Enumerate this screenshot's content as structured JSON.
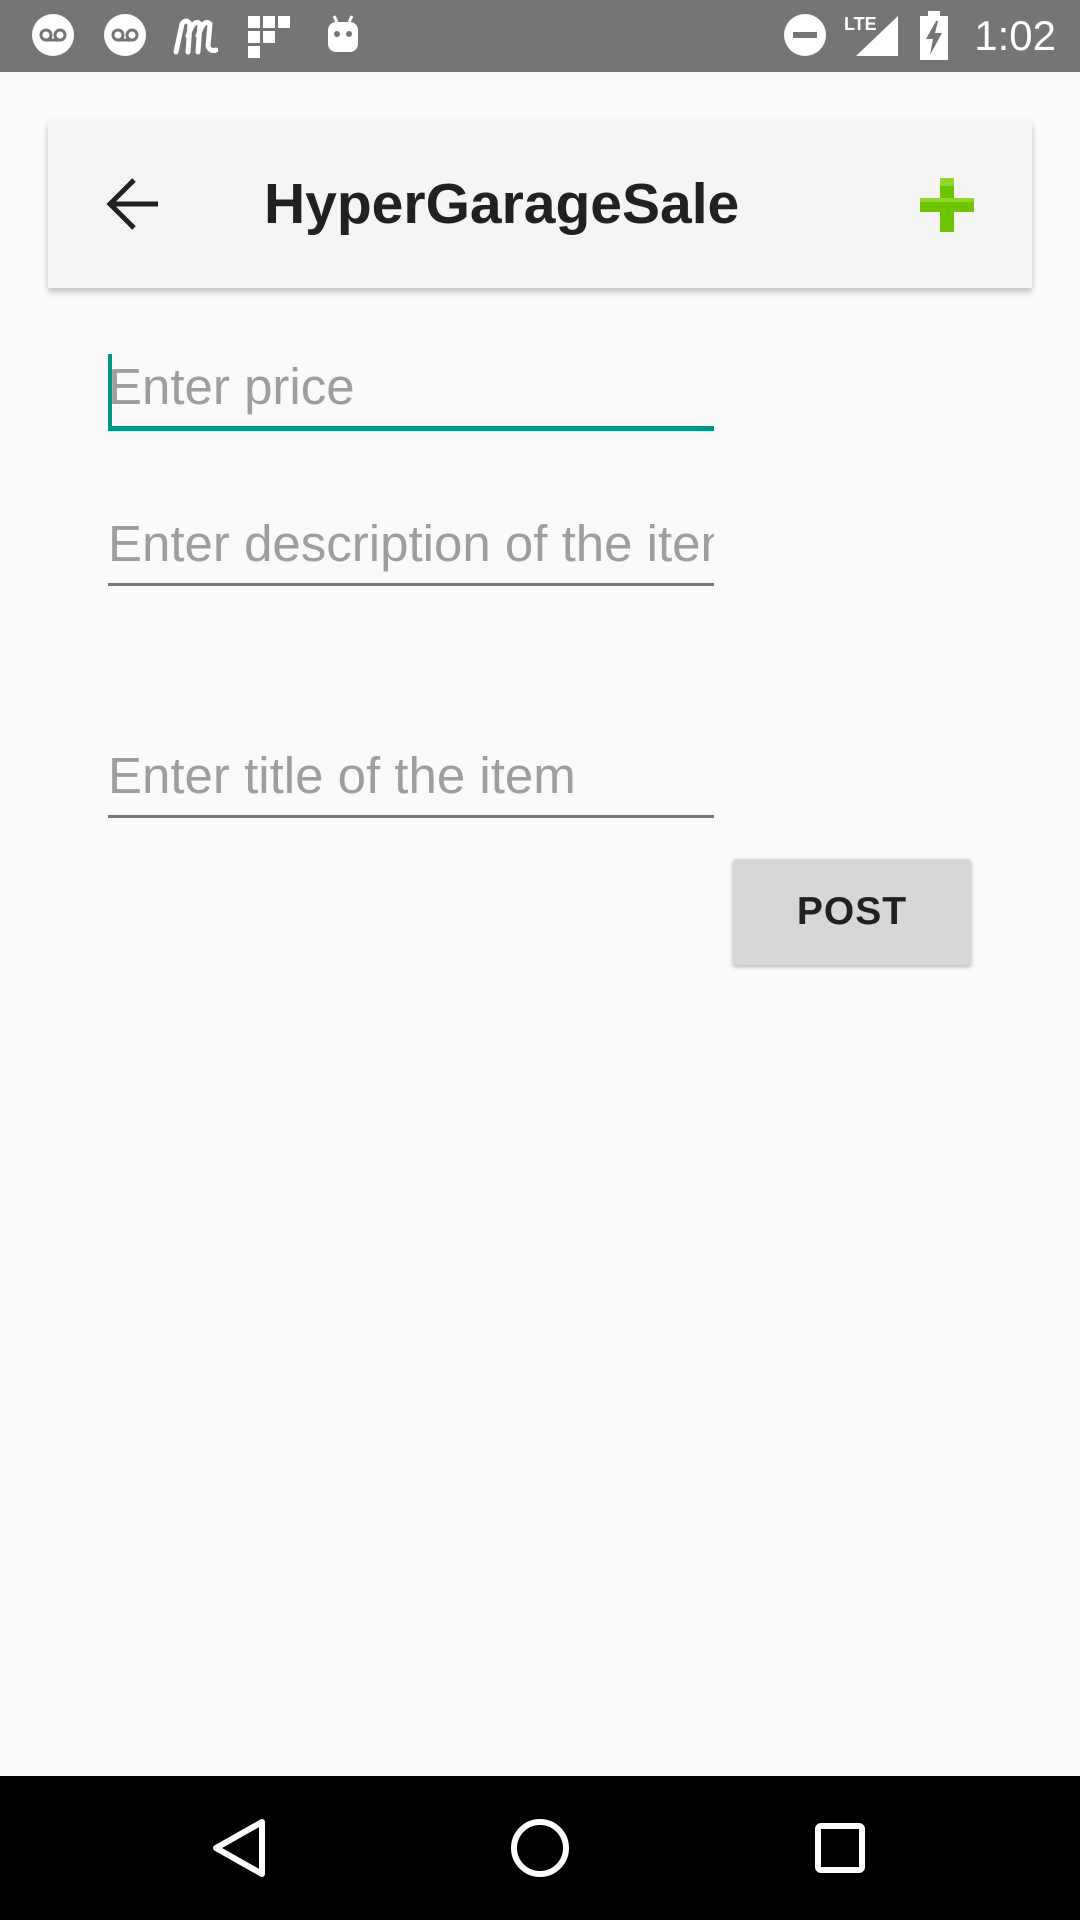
{
  "status_bar": {
    "time": "1:02",
    "network": "LTE",
    "icons": [
      "voicemail-icon",
      "voicemail-icon",
      "app-m-icon",
      "app-grid-icon",
      "android-icon",
      "do-not-disturb-icon",
      "signal-icon",
      "battery-charging-icon"
    ]
  },
  "app_bar": {
    "title": "HyperGarageSale",
    "back_icon": "arrow-back-icon",
    "action_icon": "plus-icon",
    "action_color": "#6fc400"
  },
  "form": {
    "price": {
      "placeholder": "Enter price",
      "value": ""
    },
    "description": {
      "placeholder": "Enter description of the item",
      "value": ""
    },
    "title": {
      "placeholder": "Enter title of the item",
      "value": ""
    },
    "post_label": "POST"
  },
  "colors": {
    "accent": "#009688",
    "status_bar": "#757575",
    "background": "#fafafa",
    "button": "#d6d7d7"
  },
  "nav_bar": {
    "icons": [
      "back-triangle-icon",
      "home-circle-icon",
      "recents-square-icon"
    ]
  }
}
